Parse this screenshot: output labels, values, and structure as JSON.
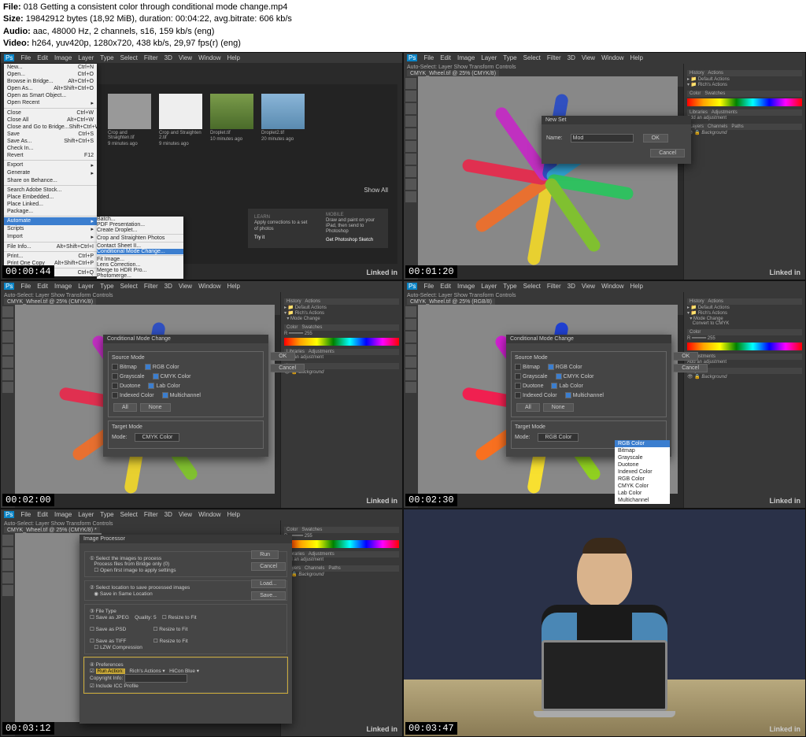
{
  "header": {
    "file_lbl": "File:",
    "file_val": "018 Getting a consistent color through conditional mode change.mp4",
    "size_lbl": "Size:",
    "size_val": "19842912 bytes (18,92 MiB), duration: 00:04:22, avg.bitrate: 606 kb/s",
    "audio_lbl": "Audio:",
    "audio_val": "aac, 48000 Hz, 2 channels, s16, 159 kb/s (eng)",
    "video_lbl": "Video:",
    "video_val": "h264, yuv420p, 1280x720, 438 kb/s, 29,97 fps(r) (eng)"
  },
  "ts": [
    "00:00:44",
    "00:01:20",
    "00:02:00",
    "00:02:30",
    "00:03:12",
    "00:03:47"
  ],
  "linkedin": "Linked in",
  "menubar": [
    "File",
    "Edit",
    "Image",
    "Layer",
    "Type",
    "Select",
    "Filter",
    "3D",
    "View",
    "Window",
    "Help"
  ],
  "file_menu": [
    {
      "l": "New...",
      "s": "Ctrl+N"
    },
    {
      "l": "Open...",
      "s": "Ctrl+O"
    },
    {
      "l": "Browse in Bridge...",
      "s": "Alt+Ctrl+O"
    },
    {
      "l": "Open As...",
      "s": "Alt+Shift+Ctrl+O"
    },
    {
      "l": "Open as Smart Object...",
      "s": ""
    },
    {
      "l": "Open Recent",
      "s": "▸"
    },
    {
      "sep": true
    },
    {
      "l": "Close",
      "s": "Ctrl+W"
    },
    {
      "l": "Close All",
      "s": "Alt+Ctrl+W"
    },
    {
      "l": "Close and Go to Bridge...",
      "s": "Shift+Ctrl+W"
    },
    {
      "l": "Save",
      "s": "Ctrl+S"
    },
    {
      "l": "Save As...",
      "s": "Shift+Ctrl+S"
    },
    {
      "l": "Check In...",
      "s": ""
    },
    {
      "l": "Revert",
      "s": "F12"
    },
    {
      "sep": true
    },
    {
      "l": "Export",
      "s": "▸"
    },
    {
      "l": "Generate",
      "s": "▸"
    },
    {
      "l": "Share on Behance...",
      "s": ""
    },
    {
      "sep": true
    },
    {
      "l": "Search Adobe Stock...",
      "s": ""
    },
    {
      "l": "Place Embedded...",
      "s": ""
    },
    {
      "l": "Place Linked...",
      "s": ""
    },
    {
      "l": "Package...",
      "s": ""
    },
    {
      "sep": true
    },
    {
      "l": "Automate",
      "s": "▸",
      "hl": true
    },
    {
      "l": "Scripts",
      "s": "▸"
    },
    {
      "l": "Import",
      "s": "▸"
    },
    {
      "sep": true
    },
    {
      "l": "File Info...",
      "s": "Alt+Shift+Ctrl+I"
    },
    {
      "sep": true
    },
    {
      "l": "Print...",
      "s": "Ctrl+P"
    },
    {
      "l": "Print One Copy",
      "s": "Alt+Shift+Ctrl+P"
    },
    {
      "sep": true
    },
    {
      "l": "Exit",
      "s": "Ctrl+Q"
    }
  ],
  "sub_menu": [
    "Batch...",
    "PDF Presentation...",
    "Create Droplet...",
    "—",
    "Crop and Straighten Photos",
    "—",
    "Contact Sheet II...",
    "—",
    "Fit Image...",
    "Lens Correction...",
    "Merge to HDR Pro...",
    "Photomerge..."
  ],
  "sub_hl": "Conditional Mode Change...",
  "ws": {
    "thumbs": [
      {
        "n": "Crop and Straighten.tif",
        "s": "9 minutes ago"
      },
      {
        "n": "Crop and Straighten 2.tif",
        "s": "9 minutes ago"
      },
      {
        "n": "Droplet.tif",
        "s": "10 minutes ago"
      },
      {
        "n": "Droplet2.tif",
        "s": "20 minutes ago"
      }
    ],
    "showall": "Show All",
    "learn1_t": "LEARN",
    "learn1": "Apply corrections to a set of photos",
    "learn2_t": "MOBILE",
    "learn2": "Draw and paint on your iPad, then send to Photoshop",
    "try": "Try it",
    "get": "Get Photoshop Sketch"
  },
  "tab2": "CMYK_Wheel.tif @ 25% (CMYK/8)",
  "tab2b": "CMYK_Wheel.tif @ 25% (CMYK/8) *",
  "tab4": "CMYK_Wheel.tif @ 25% (RGB/8)",
  "opt": "Auto-Select:   Layer    Show Transform Controls",
  "newset": {
    "title": "New Set",
    "name_lbl": "Name:",
    "val": "Mod",
    "ok": "OK",
    "cancel": "Cancel"
  },
  "panels": {
    "history": "History",
    "actions": "Actions",
    "color": "Color",
    "swatches": "Swatches",
    "libraries": "Libraries",
    "adjustments": "Adjustments",
    "addadj": "Add an adjustment",
    "layers": "Layers",
    "channels": "Channels",
    "paths": "Paths",
    "bg": "Background",
    "def": "Default Actions",
    "rich": "Rich's Actions",
    "mode": "Mode Change",
    "conv": "Convert to CMYK"
  },
  "cmc": {
    "title": "Conditional Mode Change",
    "source": "Source Mode",
    "target": "Target Mode",
    "bitmap": "Bitmap",
    "gray": "Grayscale",
    "duo": "Duotone",
    "idx": "Indexed Color",
    "rgb": "RGB Color",
    "cmyk": "CMYK Color",
    "lab": "Lab Color",
    "multi": "Multichannel",
    "all": "All",
    "none": "None",
    "mode_lbl": "Mode:",
    "mode_val": "CMYK Color",
    "ok": "OK",
    "cancel": "Cancel"
  },
  "dd": [
    "RGB Color",
    "Bitmap",
    "Grayscale",
    "Duotone",
    "Indexed Color",
    "RGB Color",
    "CMYK Color",
    "Lab Color",
    "Multichannel"
  ],
  "ip": {
    "title": "Image Processor",
    "run": "Run",
    "cancel": "Cancel",
    "load": "Load...",
    "save": "Save...",
    "s1": "Select the images to process",
    "s1a": "Process files from Bridge only (0)",
    "s1b": "Open first image to apply settings",
    "s2": "Select location to save processed images",
    "s2a": "Save in Same Location",
    "ft": "File Type",
    "jpeg": "Save as JPEG",
    "q": "Quality:",
    "psd": "Save as PSD",
    "tiff": "Save as TIFF",
    "resize": "Resize to Fit",
    "lzw": "LZW Compression",
    "pref": "Preferences",
    "ra": "Run Action:",
    "act": "Rich's Actions",
    "step": "HiCon Blue",
    "cp": "Copyright Info:",
    "icc": "Include ICC Profile"
  }
}
